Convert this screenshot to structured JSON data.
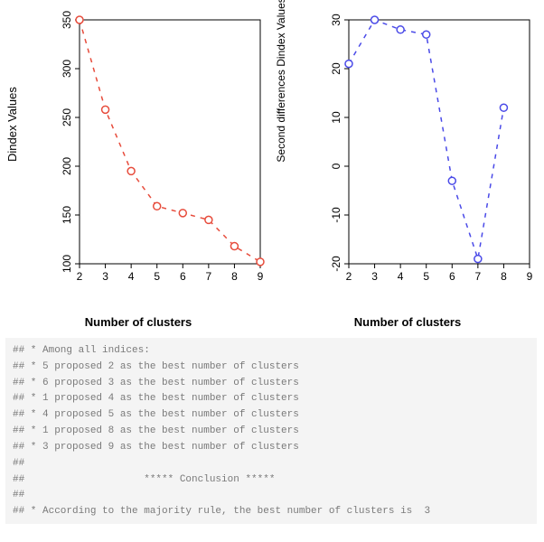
{
  "chart_data": [
    {
      "type": "line",
      "title": "",
      "xlabel": "Number of clusters",
      "ylabel": "Dindex Values",
      "xlim": [
        2,
        9
      ],
      "ylim": [
        100,
        350
      ],
      "xticks": [
        2,
        3,
        4,
        5,
        6,
        7,
        8,
        9
      ],
      "yticks": [
        100,
        150,
        200,
        250,
        300,
        350
      ],
      "color": "#e74c3c",
      "series": [
        {
          "name": "Dindex",
          "x": [
            2,
            3,
            4,
            5,
            6,
            7,
            8,
            9
          ],
          "y": [
            350,
            258,
            195,
            159,
            152,
            145,
            118,
            102
          ]
        }
      ]
    },
    {
      "type": "line",
      "title": "",
      "xlabel": "Number of clusters",
      "ylabel": "Second differences Dindex Values",
      "xlim": [
        2,
        9
      ],
      "ylim": [
        -20,
        30
      ],
      "xticks": [
        2,
        3,
        4,
        5,
        6,
        7,
        8,
        9
      ],
      "yticks": [
        -20,
        -10,
        0,
        10,
        20,
        30
      ],
      "color": "#4a4ae8",
      "series": [
        {
          "name": "SecondDiff",
          "x": [
            2,
            3,
            4,
            5,
            6,
            7,
            8
          ],
          "y": [
            21,
            30,
            28,
            27,
            -3,
            -19,
            12
          ]
        }
      ]
    }
  ],
  "console_lines": [
    "## * Among all indices:",
    "## * 5 proposed 2 as the best number of clusters",
    "## * 6 proposed 3 as the best number of clusters",
    "## * 1 proposed 4 as the best number of clusters",
    "## * 4 proposed 5 as the best number of clusters",
    "## * 1 proposed 8 as the best number of clusters",
    "## * 3 proposed 9 as the best number of clusters",
    "##",
    "##                    ***** Conclusion *****",
    "##",
    "## * According to the majority rule, the best number of clusters is  3"
  ]
}
